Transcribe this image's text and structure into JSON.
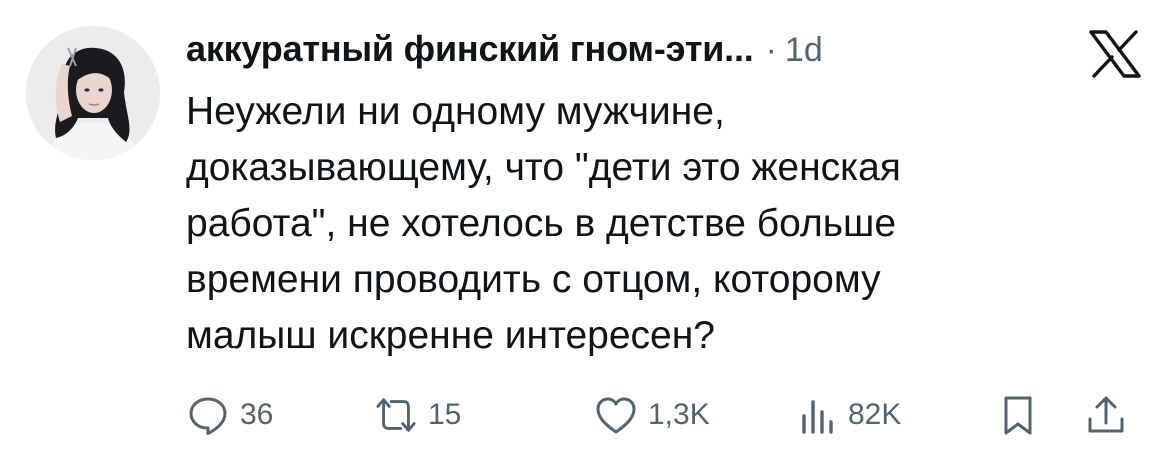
{
  "author": {
    "display_name": "аккуратный финский гном-эти...",
    "separator": "·",
    "timestamp": "1d"
  },
  "tweet": {
    "text": "Неужели ни одному мужчине,\nдоказывающему, что \"дети это женская\nработа\", не хотелось в детстве больше\nвремени проводить с отцом, которому\nмалыш искренне интересен?"
  },
  "actions": {
    "replies": "36",
    "reposts": "15",
    "likes": "1,3K",
    "views": "82K"
  },
  "icons": {
    "brand": "x-logo-icon",
    "reply": "reply-icon",
    "repost": "repost-icon",
    "like": "heart-icon",
    "views": "views-chart-icon",
    "bookmark": "bookmark-icon",
    "share": "share-icon"
  },
  "colors": {
    "text": "#0f1419",
    "secondary": "#536471",
    "background": "#ffffff"
  }
}
